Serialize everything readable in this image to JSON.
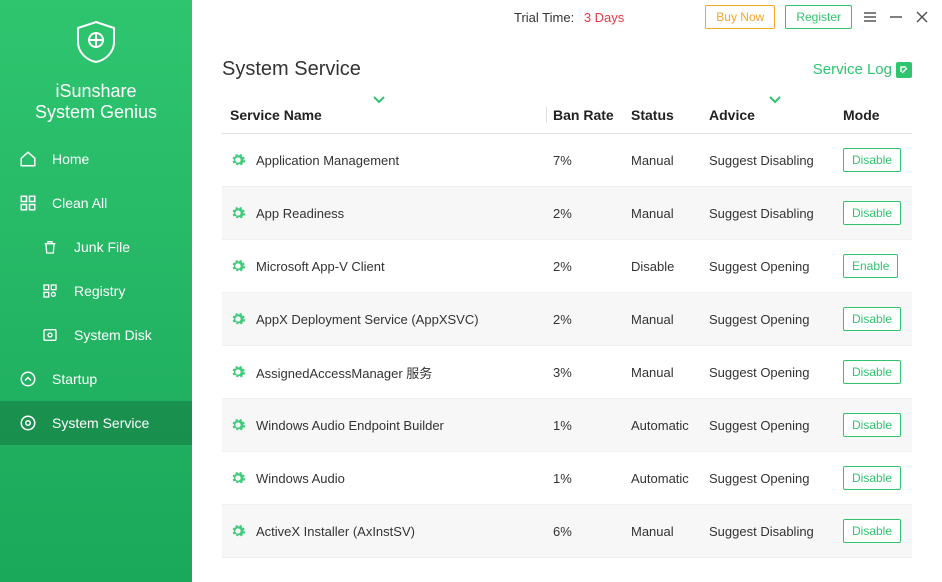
{
  "app": {
    "name_line1": "iSunshare",
    "name_line2": "System Genius"
  },
  "titlebar": {
    "trial_label": "Trial Time:",
    "trial_days": "3 Days",
    "buy": "Buy Now",
    "register": "Register"
  },
  "sidebar": {
    "items": [
      {
        "label": "Home"
      },
      {
        "label": "Clean All"
      },
      {
        "label": "Junk File"
      },
      {
        "label": "Registry"
      },
      {
        "label": "System Disk"
      },
      {
        "label": "Startup"
      },
      {
        "label": "System Service"
      }
    ]
  },
  "page": {
    "title": "System Service",
    "service_log": "Service Log"
  },
  "columns": {
    "name": "Service Name",
    "ban": "Ban Rate",
    "status": "Status",
    "advice": "Advice",
    "mode": "Mode"
  },
  "services": [
    {
      "name": "Application Management",
      "ban": "7%",
      "status": "Manual",
      "advice": "Suggest Disabling",
      "mode": "Disable"
    },
    {
      "name": "App Readiness",
      "ban": "2%",
      "status": "Manual",
      "advice": "Suggest Disabling",
      "mode": "Disable"
    },
    {
      "name": "Microsoft App-V Client",
      "ban": "2%",
      "status": "Disable",
      "advice": "Suggest Opening",
      "mode": "Enable"
    },
    {
      "name": "AppX Deployment Service (AppXSVC)",
      "ban": "2%",
      "status": "Manual",
      "advice": "Suggest Opening",
      "mode": "Disable"
    },
    {
      "name": "AssignedAccessManager 服务",
      "ban": "3%",
      "status": "Manual",
      "advice": "Suggest Opening",
      "mode": "Disable"
    },
    {
      "name": "Windows Audio Endpoint Builder",
      "ban": "1%",
      "status": "Automatic",
      "advice": "Suggest Opening",
      "mode": "Disable"
    },
    {
      "name": "Windows Audio",
      "ban": "1%",
      "status": "Automatic",
      "advice": "Suggest Opening",
      "mode": "Disable"
    },
    {
      "name": "ActiveX Installer (AxInstSV)",
      "ban": "6%",
      "status": "Manual",
      "advice": "Suggest Disabling",
      "mode": "Disable"
    }
  ]
}
